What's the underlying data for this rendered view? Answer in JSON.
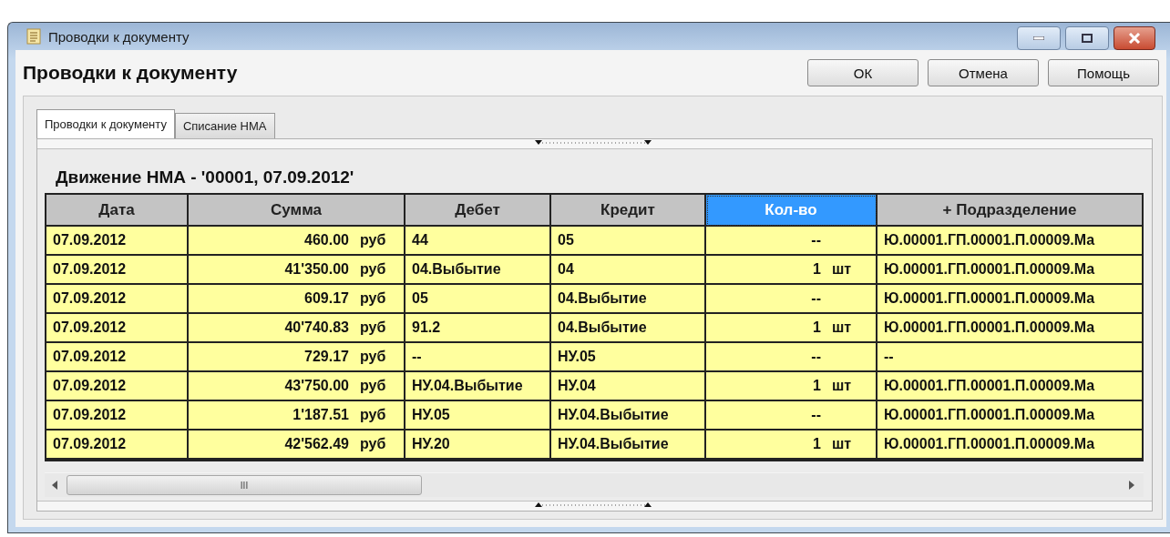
{
  "window": {
    "title": "Проводки к документу"
  },
  "header": {
    "title": "Проводки к документу"
  },
  "buttons": [
    "ОК",
    "Отмена",
    "Помощь"
  ],
  "tabs": [
    {
      "label": "Проводки к документу",
      "selected": true
    },
    {
      "label": "Списание НМА",
      "selected": false
    }
  ],
  "section_title": "Движение НМА - '00001, 07.09.2012'",
  "table": {
    "columns": [
      {
        "label": "Дата",
        "selected": false
      },
      {
        "label": "Сумма",
        "selected": false
      },
      {
        "label": "Дебет",
        "selected": false
      },
      {
        "label": "Кредит",
        "selected": false
      },
      {
        "label": "Кол-во",
        "selected": true
      },
      {
        "label": "+ Подразделение",
        "selected": false
      }
    ],
    "rows": [
      {
        "date": "07.09.2012",
        "amount": "460.00",
        "currency": "руб",
        "debit": "44",
        "credit": "05",
        "qty": "--",
        "division": "Ю.00001.ГП.00001.П.00009.Ма"
      },
      {
        "date": "07.09.2012",
        "amount": "41'350.00",
        "currency": "руб",
        "debit": "04.Выбытие",
        "credit": "04",
        "qty": "1",
        "unit": "шт",
        "division": "Ю.00001.ГП.00001.П.00009.Ма"
      },
      {
        "date": "07.09.2012",
        "amount": "609.17",
        "currency": "руб",
        "debit": "05",
        "credit": "04.Выбытие",
        "qty": "--",
        "division": "Ю.00001.ГП.00001.П.00009.Ма"
      },
      {
        "date": "07.09.2012",
        "amount": "40'740.83",
        "currency": "руб",
        "debit": "91.2",
        "credit": "04.Выбытие",
        "qty": "1",
        "unit": "шт",
        "division": "Ю.00001.ГП.00001.П.00009.Ма"
      },
      {
        "date": "07.09.2012",
        "amount": "729.17",
        "currency": "руб",
        "debit": "--",
        "credit": "НУ.05",
        "qty": "--",
        "division": "--"
      },
      {
        "date": "07.09.2012",
        "amount": "43'750.00",
        "currency": "руб",
        "debit": "НУ.04.Выбытие",
        "credit": "НУ.04",
        "qty": "1",
        "unit": "шт",
        "division": "Ю.00001.ГП.00001.П.00009.Ма"
      },
      {
        "date": "07.09.2012",
        "amount": "1'187.51",
        "currency": "руб",
        "debit": "НУ.05",
        "credit": "НУ.04.Выбытие",
        "qty": "--",
        "division": "Ю.00001.ГП.00001.П.00009.Ма"
      },
      {
        "date": "07.09.2012",
        "amount": "42'562.49",
        "currency": "руб",
        "debit": "НУ.20",
        "credit": "НУ.04.Выбытие",
        "qty": "1",
        "unit": "шт",
        "division": "Ю.00001.ГП.00001.П.00009.Ма"
      }
    ]
  },
  "scroll_bar": {
    "grip": "III"
  }
}
